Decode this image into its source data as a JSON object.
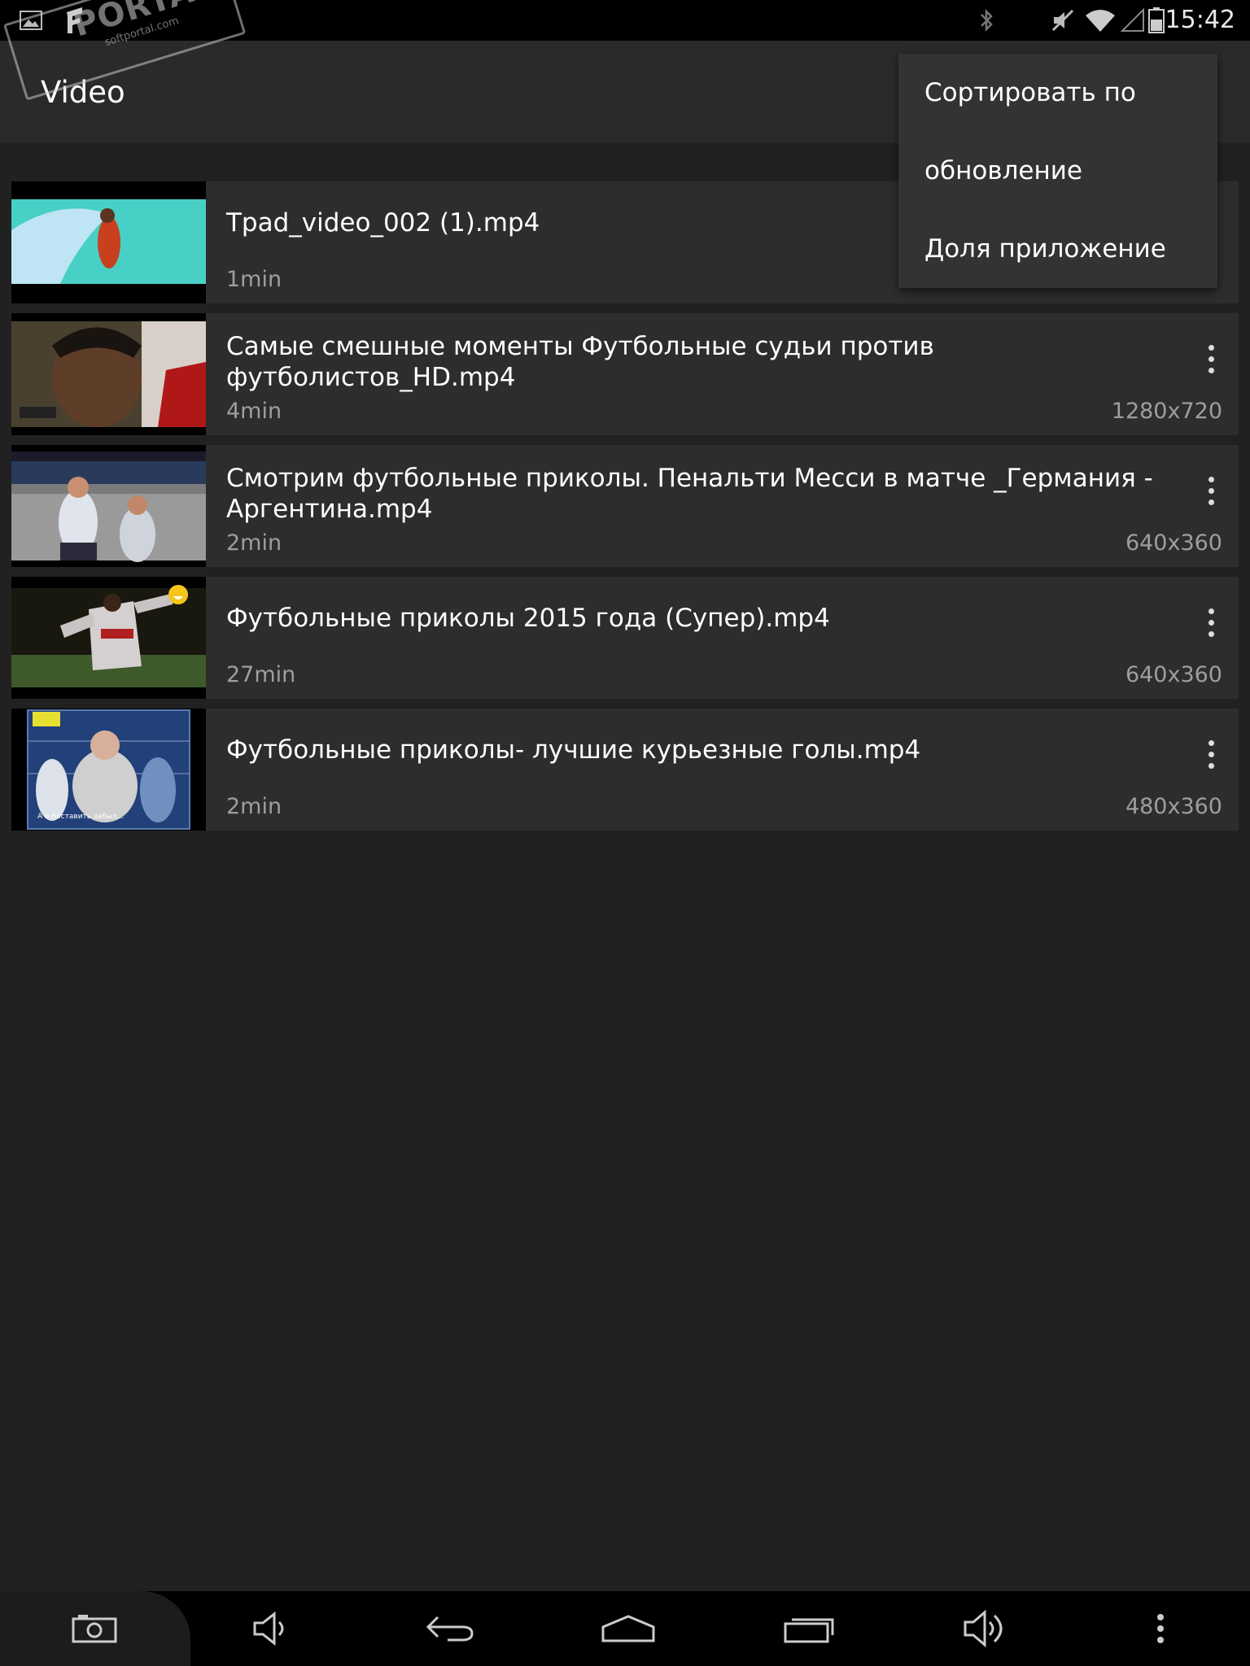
{
  "status_bar": {
    "time": "15:42"
  },
  "action_bar": {
    "title": "Video",
    "watermark": "PORTAL",
    "watermark_sub": "softportal.com"
  },
  "menu": {
    "items": [
      "Сортировать по",
      "обновление",
      "Доля приложение"
    ]
  },
  "videos": [
    {
      "title": "Tpad_video_002 (1).mp4",
      "duration": "1min",
      "resolution": "",
      "thumb_colors": [
        "#4ad0c8",
        "#a8d8f0",
        "#d04020"
      ]
    },
    {
      "title": "Самые смешные моменты Футбольные судьи против футболистов_HD.mp4",
      "duration": "4min",
      "resolution": "1280x720",
      "thumb_colors": [
        "#3a3226",
        "#8a6a50",
        "#b02020"
      ]
    },
    {
      "title": "Смотрим футбольные приколы. Пенальти Месси в матче _Германия - Аргентина.mp4",
      "duration": "2min",
      "resolution": "640x360",
      "thumb_colors": [
        "#6a6a6a",
        "#d8dce4",
        "#2a3a58"
      ]
    },
    {
      "title": "Футбольные приколы 2015 года (Супер).mp4",
      "duration": "27min",
      "resolution": "640x360",
      "thumb_colors": [
        "#1a1a14",
        "#3e5a2a",
        "#c8c8c8"
      ]
    },
    {
      "title": "Футбольные приколы- лучшие курьезные голы.mp4",
      "duration": "2min",
      "resolution": "480x360",
      "thumb_colors": [
        "#1a3a78",
        "#d0d0d0",
        "#6a8ab0"
      ]
    }
  ],
  "thumb_caption": "А я поставить забыл...",
  "colors": {
    "background": "#212121",
    "row": "#2d2d2d",
    "menu": "#333333",
    "secondary_text": "#9e9e9e"
  }
}
